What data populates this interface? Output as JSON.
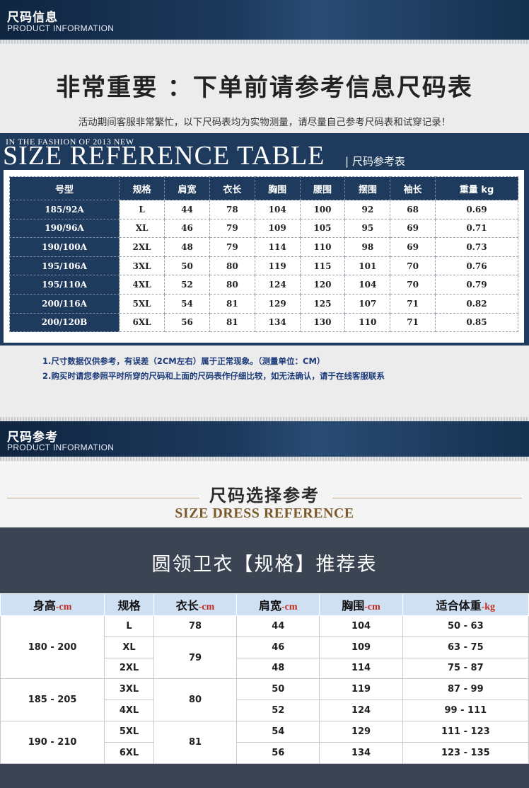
{
  "header1": {
    "title": "尺码信息",
    "subtitle": "PRODUCT INFORMATION"
  },
  "important": "非常重要 ：下单前请参考信息尺码表",
  "notice": "活动期间客服非常繁忙，以下尺码表均为实物测量，请尽量自己参考尺码表和试穿记录！",
  "size_ref": {
    "fashion": "IN THE FASHION OF 2013 NEW",
    "title": "SIZE REFERENCE TABLE",
    "cn_title": "| 尺码参考表"
  },
  "table1": {
    "headers": [
      "号型",
      "规格",
      "肩宽",
      "衣长",
      "胸围",
      "腰围",
      "摆围",
      "袖长",
      "重量 kg"
    ],
    "rows": [
      [
        "185/92A",
        "L",
        "44",
        "78",
        "104",
        "100",
        "92",
        "68",
        "0.69"
      ],
      [
        "190/96A",
        "XL",
        "46",
        "79",
        "109",
        "105",
        "95",
        "69",
        "0.71"
      ],
      [
        "190/100A",
        "2XL",
        "48",
        "79",
        "114",
        "110",
        "98",
        "69",
        "0.73"
      ],
      [
        "195/106A",
        "3XL",
        "50",
        "80",
        "119",
        "115",
        "101",
        "70",
        "0.76"
      ],
      [
        "195/110A",
        "4XL",
        "52",
        "80",
        "124",
        "120",
        "104",
        "70",
        "0.79"
      ],
      [
        "200/116A",
        "5XL",
        "54",
        "81",
        "129",
        "125",
        "107",
        "71",
        "0.82"
      ],
      [
        "200/120B",
        "6XL",
        "56",
        "81",
        "134",
        "130",
        "110",
        "71",
        "0.85"
      ]
    ]
  },
  "notes": [
    "1.尺寸数据仅供参考，有误差（2CM左右）属于正常现象。（测量单位：CM）",
    "2.购买时请您参照平时所穿的尺码和上面的尺码表作仔细比较，如无法确认，请于在线客服联系"
  ],
  "header2": {
    "title": "尺码参考",
    "subtitle": "PRODUCT INFORMATION"
  },
  "dress_ref": {
    "cn": "尺码选择参考",
    "en": "SIZE DRESS REFERENCE"
  },
  "table2": {
    "title": "圆领卫衣【规格】推荐表",
    "headers": [
      {
        "main": "身高",
        "unit": "-cm"
      },
      {
        "main": "规格",
        "unit": ""
      },
      {
        "main": "衣长",
        "unit": "-cm"
      },
      {
        "main": "肩宽",
        "unit": "-cm"
      },
      {
        "main": "胸围",
        "unit": "-cm"
      },
      {
        "main": "适合体重",
        "unit": "-kg"
      }
    ],
    "heights": [
      "180 - 200",
      "185 - 205",
      "190 - 210"
    ],
    "lengths": [
      "78",
      "79",
      "80",
      "81"
    ],
    "rows": [
      {
        "size": "L",
        "shoulder": "44",
        "chest": "104",
        "weight": "50 - 63"
      },
      {
        "size": "XL",
        "shoulder": "46",
        "chest": "109",
        "weight": "63 - 75"
      },
      {
        "size": "2XL",
        "shoulder": "48",
        "chest": "114",
        "weight": "75 - 87"
      },
      {
        "size": "3XL",
        "shoulder": "50",
        "chest": "119",
        "weight": "87 - 99"
      },
      {
        "size": "4XL",
        "shoulder": "52",
        "chest": "124",
        "weight": "99 - 111"
      },
      {
        "size": "5XL",
        "shoulder": "54",
        "chest": "129",
        "weight": "111 - 123"
      },
      {
        "size": "6XL",
        "shoulder": "56",
        "chest": "134",
        "weight": "123 - 135"
      }
    ]
  }
}
